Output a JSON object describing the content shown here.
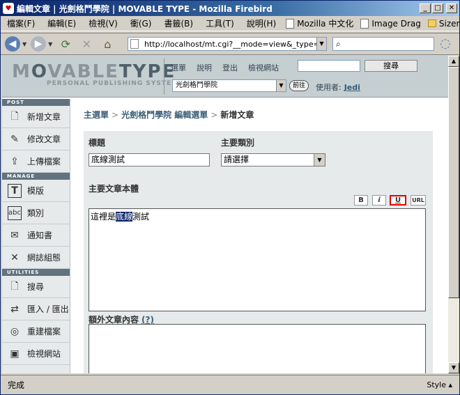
{
  "window": {
    "title": "編輯文章 | 光劍格鬥學院 | MOVABLE TYPE - Mozilla Firebird",
    "min": "_",
    "max": "□",
    "close": "✕"
  },
  "menu": {
    "items": [
      "檔案(F)",
      "編輯(E)",
      "檢視(V)",
      "衝(G)",
      "書籤(B)",
      "工具(T)",
      "說明(H)"
    ],
    "bookmarks": [
      "Mozilla 中文化",
      "Image Drag",
      "Sizer"
    ],
    "more": "»"
  },
  "nav": {
    "url": "http://localhost/mt.cgi?__mode=view&_type=entry&",
    "search_placeholder": ""
  },
  "header": {
    "logo_a": "M",
    "logo_b": "VABLE",
    "logo_c": "TYPE",
    "logo_sub": "PERSONAL PUBLISHING SYSTEM",
    "links": [
      "選單",
      "說明",
      "登出",
      "檢視網站"
    ],
    "search_button": "搜尋",
    "blog_select": "光劍格鬥學院",
    "go_button": "前往",
    "user_label": "使用者:",
    "username": "Jedi"
  },
  "sidebar": {
    "sections": [
      {
        "label": "POST",
        "items": [
          {
            "label": "新增文章",
            "icon": "new-entry-icon",
            "glyph": "🗋"
          },
          {
            "label": "修改文章",
            "icon": "edit-entries-icon",
            "glyph": "✎"
          },
          {
            "label": "上傳檔案",
            "icon": "upload-file-icon",
            "glyph": "⇪"
          }
        ]
      },
      {
        "label": "MANAGE",
        "items": [
          {
            "label": "模版",
            "icon": "templates-icon",
            "glyph": "T"
          },
          {
            "label": "類別",
            "icon": "categories-icon",
            "glyph": "abc"
          },
          {
            "label": "通知書",
            "icon": "notifications-icon",
            "glyph": "✉"
          },
          {
            "label": "網誌組態",
            "icon": "weblog-config-icon",
            "glyph": "✕"
          }
        ]
      },
      {
        "label": "UTILITIES",
        "items": [
          {
            "label": "搜尋",
            "icon": "search-icon",
            "glyph": "🗋"
          },
          {
            "label": "匯入 / 匯出",
            "icon": "import-export-icon",
            "glyph": "⇄"
          },
          {
            "label": "重建檔案",
            "icon": "rebuild-icon",
            "glyph": "◎"
          },
          {
            "label": "檢視網站",
            "icon": "view-site-icon",
            "glyph": "▣"
          }
        ]
      }
    ]
  },
  "main": {
    "breadcrumb": [
      "主選單",
      "光劍格鬥學院 編輯選單",
      "新增文章"
    ],
    "breadcrumb_sep": ">",
    "title_label": "標題",
    "title_value": "底線測試",
    "category_label": "主要類別",
    "category_value": "請選擇",
    "body_label": "主要文章本體",
    "format_buttons": [
      "B",
      "i",
      "U",
      "URL"
    ],
    "body_before": "這裡是",
    "body_selected": "底線",
    "body_after": "測試",
    "more_label": "額外文章內容",
    "more_help": "(?)"
  },
  "status": {
    "text": "完成",
    "style_button": "Style ▴"
  }
}
